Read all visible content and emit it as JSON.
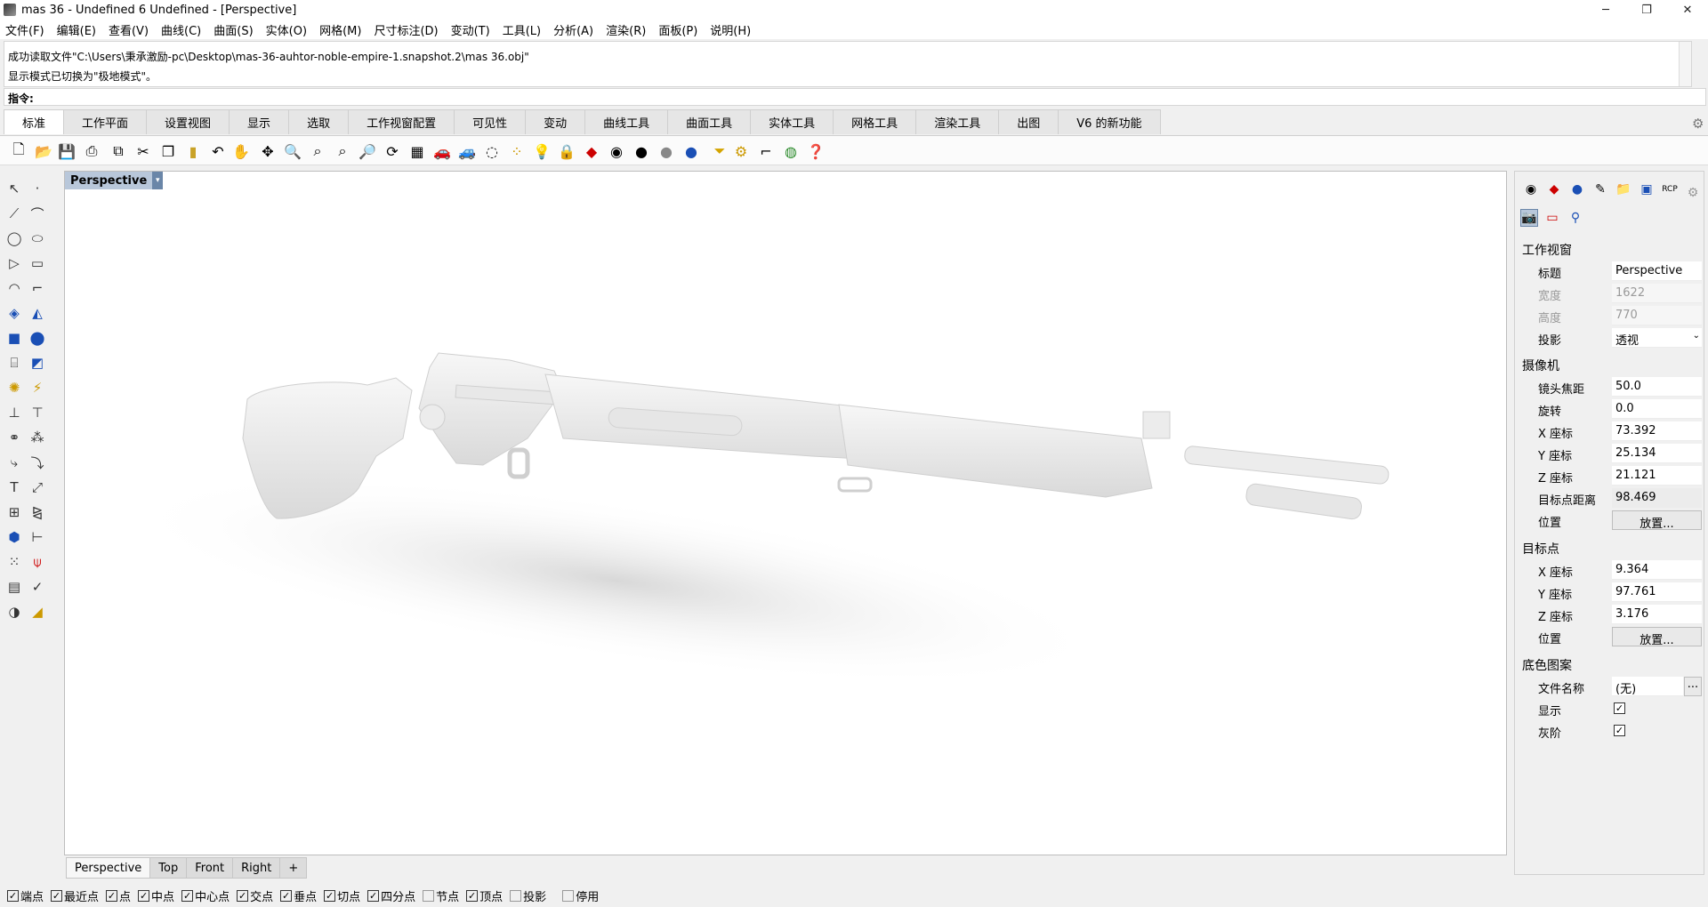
{
  "window": {
    "title": "mas 36 - Undefined 6 Undefined - [Perspective]",
    "minimize": "─",
    "maximize": "❐",
    "close": "✕"
  },
  "menu": [
    "文件(F)",
    "编辑(E)",
    "查看(V)",
    "曲线(C)",
    "曲面(S)",
    "实体(O)",
    "网格(M)",
    "尺寸标注(D)",
    "变动(T)",
    "工具(L)",
    "分析(A)",
    "渲染(R)",
    "面板(P)",
    "说明(H)"
  ],
  "command_history": [
    "成功读取文件\"C:\\Users\\秉承激励-pc\\Desktop\\mas-36-auhtor-noble-empire-1.snapshot.2\\mas 36.obj\"",
    "显示模式已切换为\"极地模式\"。"
  ],
  "command_prompt": {
    "label": "指令:",
    "value": ""
  },
  "tabs": [
    "标准",
    "工作平面",
    "设置视图",
    "显示",
    "选取",
    "工作视窗配置",
    "可见性",
    "变动",
    "曲线工具",
    "曲面工具",
    "实体工具",
    "网格工具",
    "渲染工具",
    "出图",
    "V6 的新功能"
  ],
  "active_tab": 0,
  "toolbar_icons": [
    "new-icon",
    "open-icon",
    "save-icon",
    "print-icon",
    "import-icon",
    "cut-icon",
    "copy-icon",
    "paste-icon",
    "undo-icon",
    "pan-icon",
    "move-view-icon",
    "zoom-icon",
    "zoom-window-icon",
    "zoom-extents-icon",
    "zoom-selected-icon",
    "rotate-view-icon",
    "grid-icon",
    "car-icon",
    "car-ghost-icon",
    "circle-icon",
    "points-icon",
    "light-icon",
    "lock-icon",
    "material-icon",
    "color-wheel-icon",
    "render-sphere-icon",
    "shade-sphere-icon",
    "blue-sphere-icon",
    "filter-icon",
    "settings-icon",
    "dimension-icon",
    "globe-icon",
    "help-icon"
  ],
  "viewport": {
    "label": "Perspective"
  },
  "viewport_tabs": [
    "Perspective",
    "Top",
    "Front",
    "Right",
    "+"
  ],
  "panel": {
    "section_viewport": "工作视窗",
    "title_label": "标题",
    "title_value": "Perspective",
    "width_label": "宽度",
    "width_value": "1622",
    "height_label": "高度",
    "height_value": "770",
    "projection_label": "投影",
    "projection_value": "透视",
    "section_camera": "摄像机",
    "lens_label": "镜头焦距",
    "lens_value": "50.0",
    "rotation_label": "旋转",
    "rotation_value": "0.0",
    "cx_label": "X 座标",
    "cx_value": "73.392",
    "cy_label": "Y 座标",
    "cy_value": "25.134",
    "cz_label": "Z 座标",
    "cz_value": "21.121",
    "dist_label": "目标点距离",
    "dist_value": "98.469",
    "cpos_label": "位置",
    "place_button": "放置...",
    "section_target": "目标点",
    "tx_label": "X 座标",
    "tx_value": "9.364",
    "ty_label": "Y 座标",
    "ty_value": "97.761",
    "tz_label": "Z 座标",
    "tz_value": "3.176",
    "tpos_label": "位置",
    "section_wallpaper": "底色图案",
    "file_label": "文件名称",
    "file_value": "(无)",
    "browse": "...",
    "show_label": "显示",
    "gray_label": "灰阶"
  },
  "osnaps": [
    {
      "label": "端点",
      "checked": true
    },
    {
      "label": "最近点",
      "checked": true
    },
    {
      "label": "点",
      "checked": true
    },
    {
      "label": "中点",
      "checked": true
    },
    {
      "label": "中心点",
      "checked": true
    },
    {
      "label": "交点",
      "checked": true
    },
    {
      "label": "垂点",
      "checked": true
    },
    {
      "label": "切点",
      "checked": true
    },
    {
      "label": "四分点",
      "checked": true
    },
    {
      "label": "节点",
      "checked": false
    },
    {
      "label": "顶点",
      "checked": true
    },
    {
      "label": "投影",
      "checked": false
    },
    {
      "label": "停用",
      "checked": false
    }
  ]
}
